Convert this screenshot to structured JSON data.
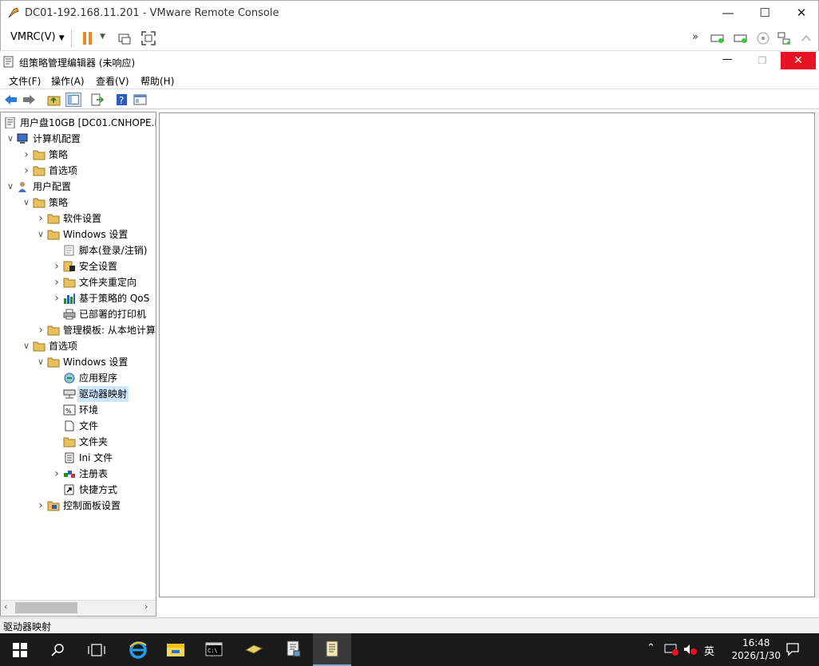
{
  "vmrc": {
    "title": "DC01-192.168.11.201 - VMware Remote Console",
    "menu": "VMRC(V)"
  },
  "gpme": {
    "title": "组策略管理编辑器 (未响应)",
    "menus": [
      "文件(F)",
      "操作(A)",
      "查看(V)",
      "帮助(H)"
    ]
  },
  "tree": [
    {
      "label": "用户盘10GB [DC01.CNHOPE.l",
      "level": 0,
      "exp": "",
      "icon": "gpo-icon"
    },
    {
      "label": "计算机配置",
      "level": 0,
      "exp": "v",
      "icon": "computer-icon"
    },
    {
      "label": "策略",
      "level": 1,
      "exp": ">",
      "icon": "folder-icon"
    },
    {
      "label": "首选项",
      "level": 1,
      "exp": ">",
      "icon": "folder-icon"
    },
    {
      "label": "用户配置",
      "level": 0,
      "exp": "v",
      "icon": "user-icon"
    },
    {
      "label": "策略",
      "level": 1,
      "exp": "v",
      "icon": "folder-icon"
    },
    {
      "label": "软件设置",
      "level": 2,
      "exp": ">",
      "icon": "folder-icon"
    },
    {
      "label": "Windows 设置",
      "level": 2,
      "exp": "v",
      "icon": "folder-icon"
    },
    {
      "label": "脚本(登录/注销)",
      "level": 3,
      "exp": "",
      "icon": "script-icon"
    },
    {
      "label": "安全设置",
      "level": 3,
      "exp": ">",
      "icon": "security-icon"
    },
    {
      "label": "文件夹重定向",
      "level": 3,
      "exp": ">",
      "icon": "folder-icon"
    },
    {
      "label": "基于策略的 QoS",
      "level": 3,
      "exp": ">",
      "icon": "chart-icon"
    },
    {
      "label": "已部署的打印机",
      "level": 3,
      "exp": "",
      "icon": "printer-icon"
    },
    {
      "label": "管理模板: 从本地计算",
      "level": 2,
      "exp": ">",
      "icon": "folder-icon"
    },
    {
      "label": "首选项",
      "level": 1,
      "exp": "v",
      "icon": "folder-icon"
    },
    {
      "label": "Windows 设置",
      "level": 2,
      "exp": "v",
      "icon": "folder-icon"
    },
    {
      "label": "应用程序",
      "level": 3,
      "exp": "",
      "icon": "application-icon"
    },
    {
      "label": "驱动器映射",
      "level": 3,
      "exp": "",
      "icon": "drive-map-icon",
      "selected": true
    },
    {
      "label": "环境",
      "level": 3,
      "exp": "",
      "icon": "environment-icon"
    },
    {
      "label": "文件",
      "level": 3,
      "exp": "",
      "icon": "file-icon"
    },
    {
      "label": "文件夹",
      "level": 3,
      "exp": "",
      "icon": "folder-icon"
    },
    {
      "label": "Ini 文件",
      "level": 3,
      "exp": "",
      "icon": "ini-file-icon"
    },
    {
      "label": "注册表",
      "level": 3,
      "exp": ">",
      "icon": "registry-icon"
    },
    {
      "label": "快捷方式",
      "level": 3,
      "exp": "",
      "icon": "shortcut-icon"
    },
    {
      "label": "控制面板设置",
      "level": 2,
      "exp": ">",
      "icon": "control-panel-icon"
    }
  ],
  "status": "驱动器映射",
  "clock": {
    "time": "16:48",
    "date": "2026/1/30"
  },
  "ime": "英",
  "colors": {
    "folder": "#e8c060",
    "close_red": "#e81123",
    "select": "#cce8ff"
  }
}
